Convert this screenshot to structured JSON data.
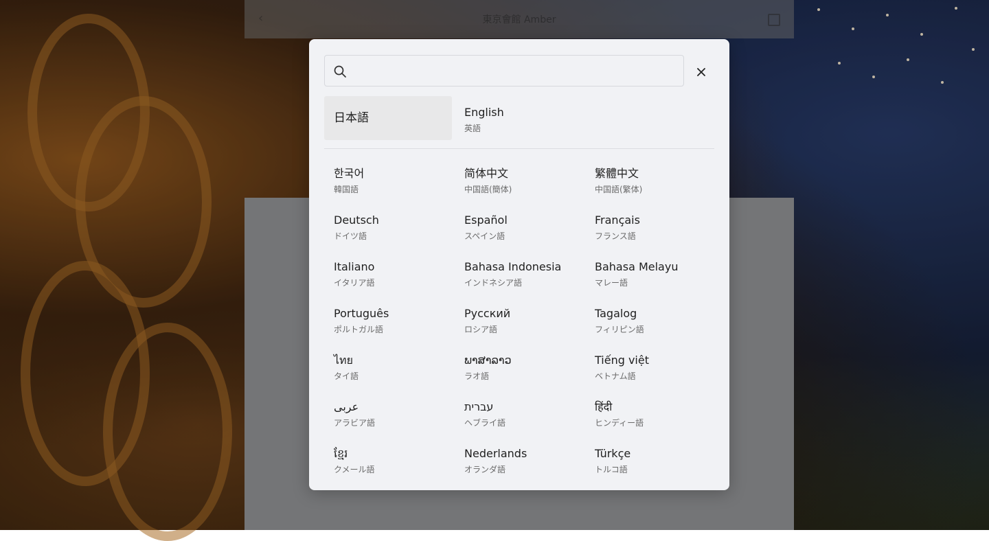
{
  "background": {
    "header_title": "東京會館 Amber",
    "back_icon": "chevron-left-icon",
    "menu_icon": "menu-icon"
  },
  "modal": {
    "search": {
      "value": "",
      "placeholder": "",
      "icon": "search-icon"
    },
    "close_icon": "close-icon",
    "selected_language": "日本語",
    "primary_languages": [
      {
        "native": "日本語",
        "japanese": ""
      },
      {
        "native": "English",
        "japanese": "英語"
      }
    ],
    "languages": [
      {
        "native": "한국어",
        "japanese": "韓国語"
      },
      {
        "native": "简体中文",
        "japanese": "中国語(簡体)"
      },
      {
        "native": "繁體中文",
        "japanese": "中国語(繁体)"
      },
      {
        "native": "Deutsch",
        "japanese": "ドイツ語"
      },
      {
        "native": "Español",
        "japanese": "スペイン語"
      },
      {
        "native": "Français",
        "japanese": "フランス語"
      },
      {
        "native": "Italiano",
        "japanese": "イタリア語"
      },
      {
        "native": "Bahasa Indonesia",
        "japanese": "インドネシア語"
      },
      {
        "native": "Bahasa Melayu",
        "japanese": "マレー語"
      },
      {
        "native": "Português",
        "japanese": "ポルトガル語"
      },
      {
        "native": "Русский",
        "japanese": "ロシア語"
      },
      {
        "native": "Tagalog",
        "japanese": "フィリピン語"
      },
      {
        "native": "ไทย",
        "japanese": "タイ語"
      },
      {
        "native": "ພາສາລາວ",
        "japanese": "ラオ語"
      },
      {
        "native": "Tiếng việt",
        "japanese": "ベトナム語"
      },
      {
        "native": "عربى",
        "japanese": "アラビア語"
      },
      {
        "native": "עברית",
        "japanese": "ヘブライ語"
      },
      {
        "native": "हिंदी",
        "japanese": "ヒンディー語"
      },
      {
        "native": "ខ្មែរ",
        "japanese": "クメール語"
      },
      {
        "native": "Nederlands",
        "japanese": "オランダ語"
      },
      {
        "native": "Türkçe",
        "japanese": "トルコ語"
      }
    ]
  },
  "colors": {
    "modal_bg": "#f1f2f5",
    "selected_bg": "#e8e8e9",
    "text_primary": "#1f1f1f",
    "text_secondary": "#6a6a6a"
  }
}
